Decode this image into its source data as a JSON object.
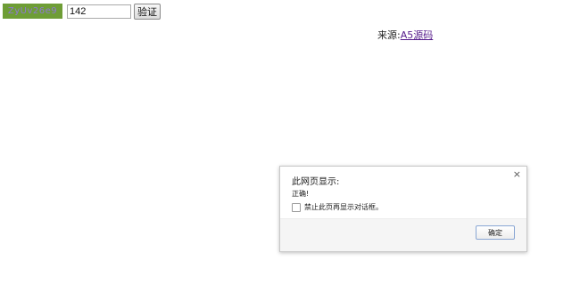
{
  "form": {
    "captcha_text": "ZyUv26e9",
    "input_value": "142",
    "verify_label": "验证"
  },
  "source": {
    "label": "来源:",
    "link_text": "A5源码"
  },
  "dialog": {
    "title": "此网页显示:",
    "message": "正确!",
    "checkbox_label": "禁止此页再显示对话框。",
    "ok_label": "确定",
    "close_glyph": "×"
  },
  "colors": {
    "captcha_bg": "#6e9d36",
    "captcha_text": "#8e79d4",
    "link": "#551a8b"
  }
}
